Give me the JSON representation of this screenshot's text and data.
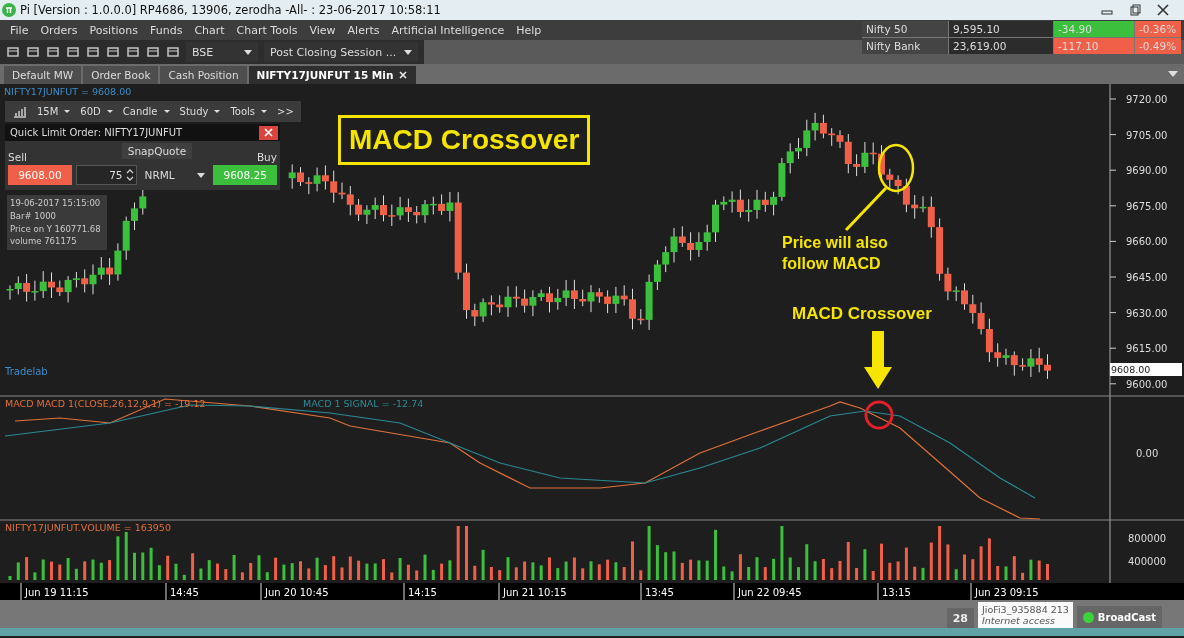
{
  "title_bar": {
    "title": "Pi [Version : 1.0.0.0] RP4686, 13906, zerodha -All- : 23-06-2017 10:58:11"
  },
  "menu": [
    "File",
    "Orders",
    "Positions",
    "Funds",
    "Chart",
    "Chart Tools",
    "View",
    "Alerts",
    "Artificial Intelligence",
    "Help"
  ],
  "toolbar": {
    "exchange": "BSE",
    "session": "Post Closing Session ..."
  },
  "index_table": [
    {
      "name": "Nifty 50",
      "value": "9,595.10",
      "change": "-34.90",
      "color": "#3cbf3c",
      "percent": "-0.36%"
    },
    {
      "name": "Nifty Bank",
      "value": "23,619.00",
      "change": "-117.10",
      "color": "#f06048",
      "percent": "-0.49%"
    }
  ],
  "tabs": [
    {
      "label": "Default MW",
      "selected": false,
      "closable": false
    },
    {
      "label": "Order Book",
      "selected": false,
      "closable": false
    },
    {
      "label": "Cash Position",
      "selected": false,
      "closable": false
    },
    {
      "label": "NIFTY17JUNFUT 15 Min",
      "selected": true,
      "closable": true
    }
  ],
  "chart": {
    "symbol_label": "NIFTY17JUNFUT = 9608.00",
    "chart_toolbar": [
      "15M",
      "60D",
      "Candle",
      "Study",
      "Tools"
    ],
    "more": ">>",
    "order_panel": {
      "title": "Quick Limit Order: NIFTY17JUNFUT",
      "snapquote": "SnapQuote",
      "sell_label": "Sell",
      "sell_price": "9608.00",
      "quantity": "75",
      "product": "NRML",
      "buy_label": "Buy",
      "buy_price": "9608.25"
    },
    "info": [
      "19-06-2017 15:15:00",
      "Bar# 1000",
      "Price on Y  160771.68",
      "volume  761175"
    ],
    "watermark": "Tradelab",
    "price_ticks": [
      "9720.00",
      "9705.00",
      "9690.00",
      "9675.00",
      "9660.00",
      "9645.00",
      "9630.00",
      "9615.00",
      "9600.00"
    ],
    "current_price": "9608.00",
    "annotations": {
      "title": "MACD Crossover",
      "note": "Price will also follow MACD",
      "crossover_label": "MACD Crossover"
    },
    "macd": {
      "label": "MACD MACD 1(CLOSE,26,12,9,1) = -19.12",
      "signal_label": "MACD 1 SIGNAL = -12.74",
      "zero_tick": "0.00"
    },
    "volume": {
      "label": "NIFTY17JUNFUT.VOLUME = 163950",
      "ticks": [
        "800000",
        "400000"
      ]
    },
    "time_labels": [
      "Jun 19 11:15",
      "14:45",
      "Jun 20 10:45",
      "14:15",
      "Jun 21 10:15",
      "13:45",
      "Jun 22 09:45",
      "13:15",
      "Jun 23 09:15"
    ]
  },
  "status_bar": {
    "count": "28",
    "network": "JioFi3_935884  213",
    "network_status": "Internet access",
    "broadcast": "BroadCast",
    "broadcast_on": true
  }
}
